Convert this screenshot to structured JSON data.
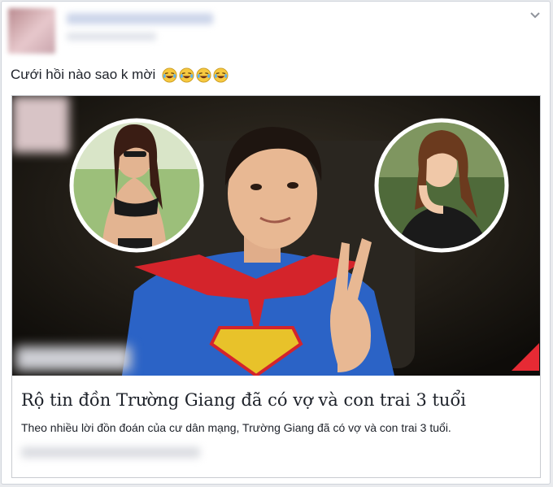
{
  "post": {
    "status_text": "Cưới hồi nào sao k mời",
    "emojis": [
      "laughing-tears-emoji",
      "laughing-tears-emoji",
      "laughing-tears-emoji",
      "laughing-tears-emoji"
    ],
    "options_icon": "chevron-down-icon"
  },
  "link_card": {
    "title": "Rộ tin đồn Trường Giang đã có vợ và con trai 3 tuổi",
    "description": "Theo nhiều lời đồn đoán của cư dân mạng, Trường Giang đã có vợ và con trai 3 tuổi."
  },
  "colors": {
    "accent_red": "#e62a34",
    "shirt_blue": "#2b63c6",
    "cape_red": "#d4242b",
    "text": "#1d2129"
  }
}
